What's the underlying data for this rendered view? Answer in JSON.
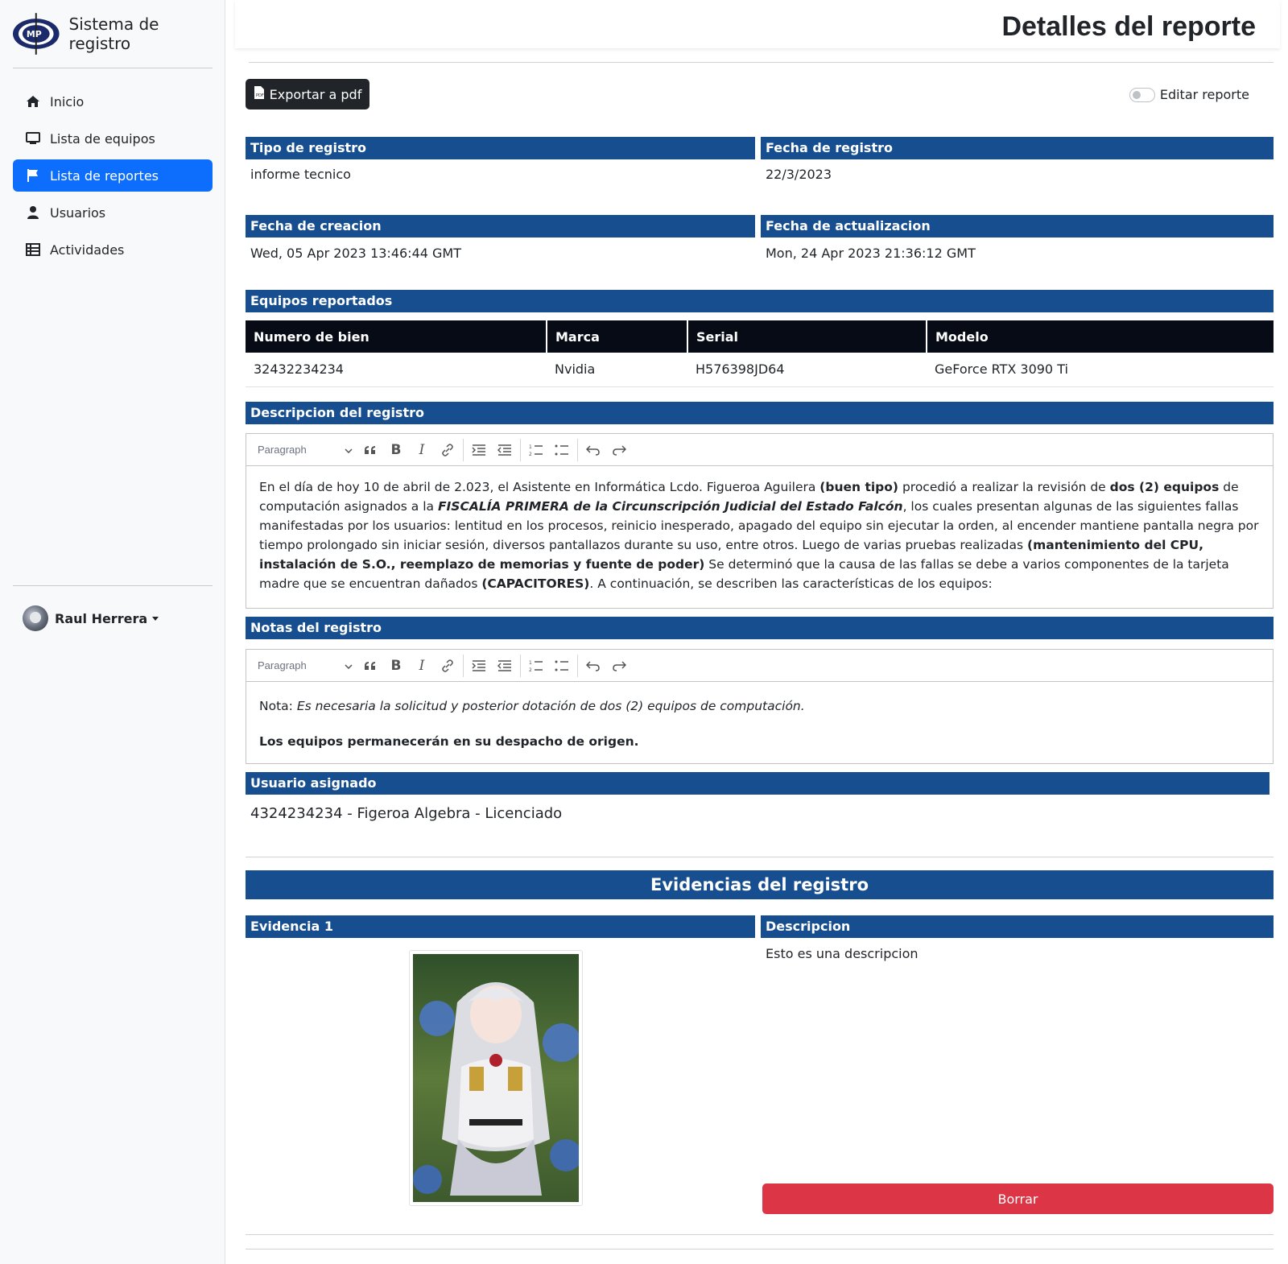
{
  "app": {
    "brand": "Sistema de registro",
    "logo_text": "MP"
  },
  "sidebar": {
    "items": [
      {
        "label": "Inicio",
        "icon": "home-icon"
      },
      {
        "label": "Lista de equipos",
        "icon": "monitor-icon"
      },
      {
        "label": "Lista de reportes",
        "icon": "flag-icon",
        "active": true
      },
      {
        "label": "Usuarios",
        "icon": "user-icon"
      },
      {
        "label": "Actividades",
        "icon": "table-icon"
      }
    ],
    "user": {
      "name": "Raul Herrera"
    }
  },
  "header": {
    "title": "Detalles del reporte"
  },
  "actions": {
    "export_label": "Exportar a pdf",
    "edit_toggle_label": "Editar reporte",
    "edit_enabled": false
  },
  "fields": {
    "tipo": {
      "label": "Tipo de registro",
      "value": "informe tecnico"
    },
    "fecha_registro": {
      "label": "Fecha de registro",
      "value": "22/3/2023"
    },
    "fecha_creacion": {
      "label": "Fecha de creacion",
      "value": "Wed, 05 Apr 2023 13:46:44 GMT"
    },
    "fecha_actualizacion": {
      "label": "Fecha de actualizacion",
      "value": "Mon, 24 Apr 2023 21:36:12 GMT"
    }
  },
  "equipos": {
    "label": "Equipos reportados",
    "columns": [
      "Numero de bien",
      "Marca",
      "Serial",
      "Modelo"
    ],
    "rows": [
      [
        "32432234234",
        "Nvidia",
        "H576398JD64",
        "GeForce RTX 3090 Ti"
      ]
    ]
  },
  "editor_toolbar": {
    "paragraph_label": "Paragraph"
  },
  "descripcion": {
    "label": "Descripcion del registro",
    "t1": "En el día de hoy 10 de abril de 2.023, el Asistente en Informática Lcdo. Figueroa Aguilera ",
    "b1": "(buen tipo)",
    "t2": " procedió a realizar la revisión de ",
    "b2": "dos (2) equipos",
    "t3": " de computación asignados a la ",
    "bi1": "FISCALÍA PRIMERA de la Circunscripción Judicial del Estado Falcón",
    "t4": ", los cuales presentan algunas de las siguientes fallas manifestadas por los usuarios: lentitud en los procesos, reinicio inesperado, apagado del equipo sin ejecutar la orden, al encender mantiene pantalla negra por tiempo prolongado sin iniciar sesión, diversos pantallazos durante su uso, entre otros. Luego de varias pruebas realizadas ",
    "b3": "(mantenimiento del CPU, instalación de S.O., reemplazo de memorias y fuente de poder)",
    "t5": " Se determinó que la causa de las fallas se debe a varios componentes de la tarjeta madre que se encuentran dañados ",
    "b4": "(CAPACITORES)",
    "t6": ". A continuación, se describen las características de los equipos:"
  },
  "notas": {
    "label": "Notas del registro",
    "prefix": "Nota: ",
    "italic": "Es necesaria la solicitud y posterior dotación de dos (2) equipos de computación.",
    "bold_line": "Los equipos permanecerán en su despacho de origen."
  },
  "usuario": {
    "label": "Usuario asignado",
    "value": "4324234234 - Figeroa Algebra - Licenciado"
  },
  "evidencias": {
    "title": "Evidencias del registro",
    "items": [
      {
        "label": "Evidencia 1",
        "desc_label": "Descripcion",
        "description": "Esto es una descripcion",
        "delete_label": "Borrar"
      }
    ]
  }
}
